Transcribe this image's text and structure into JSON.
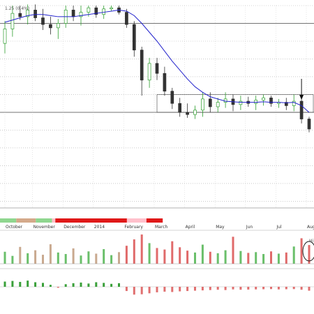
{
  "chart_data": {
    "type": "candlestick",
    "header_text": "1.25 (0.4%)",
    "volume_annotation": "Hi",
    "months": [
      "October",
      "November",
      "December",
      "2014",
      "February",
      "March",
      "April",
      "May",
      "Jun",
      "Jul",
      "August"
    ],
    "bands": [
      {
        "color": "#8fd68f",
        "weeks": 5
      },
      {
        "color": "#d4a98a",
        "weeks": 6
      },
      {
        "color": "#8fd68f",
        "weeks": 5
      },
      {
        "color": "#ffc0cb",
        "weeks": 1
      },
      {
        "color": "#e01818",
        "weeks": 22
      },
      {
        "color": "#ffc0cb",
        "weeks": 6
      },
      {
        "color": "#e01818",
        "weeks": 5
      }
    ],
    "candles": [
      {
        "o": 22.2,
        "h": 24.2,
        "l": 21.3,
        "c": 23.5
      },
      {
        "o": 23.5,
        "h": 25.6,
        "l": 22.8,
        "c": 24.9
      },
      {
        "o": 24.9,
        "h": 25.6,
        "l": 24.3,
        "c": 24.6
      },
      {
        "o": 24.6,
        "h": 25.7,
        "l": 23.9,
        "c": 25.2
      },
      {
        "o": 25.2,
        "h": 25.7,
        "l": 24.2,
        "c": 24.5
      },
      {
        "o": 24.5,
        "h": 25.3,
        "l": 23.4,
        "c": 23.9
      },
      {
        "o": 23.9,
        "h": 24.6,
        "l": 23.0,
        "c": 23.6
      },
      {
        "o": 23.6,
        "h": 24.4,
        "l": 22.6,
        "c": 24.0
      },
      {
        "o": 24.0,
        "h": 25.6,
        "l": 23.6,
        "c": 25.2
      },
      {
        "o": 25.2,
        "h": 25.6,
        "l": 24.2,
        "c": 24.6
      },
      {
        "o": 24.6,
        "h": 25.6,
        "l": 23.8,
        "c": 25.0
      },
      {
        "o": 25.0,
        "h": 25.6,
        "l": 24.6,
        "c": 25.4
      },
      {
        "o": 25.4,
        "h": 25.6,
        "l": 24.5,
        "c": 24.8
      },
      {
        "o": 24.8,
        "h": 25.6,
        "l": 24.4,
        "c": 25.3
      },
      {
        "o": 25.3,
        "h": 25.6,
        "l": 25.1,
        "c": 25.4
      },
      {
        "o": 25.4,
        "h": 25.6,
        "l": 24.8,
        "c": 25.0
      },
      {
        "o": 25.0,
        "h": 25.3,
        "l": 23.6,
        "c": 23.9
      },
      {
        "o": 23.9,
        "h": 24.2,
        "l": 21.0,
        "c": 21.6
      },
      {
        "o": 21.6,
        "h": 21.9,
        "l": 17.5,
        "c": 18.9
      },
      {
        "o": 18.9,
        "h": 20.9,
        "l": 18.2,
        "c": 20.4
      },
      {
        "o": 20.4,
        "h": 20.9,
        "l": 18.9,
        "c": 19.5
      },
      {
        "o": 19.5,
        "h": 20.1,
        "l": 17.5,
        "c": 17.9
      },
      {
        "o": 17.9,
        "h": 18.2,
        "l": 16.3,
        "c": 16.8
      },
      {
        "o": 16.8,
        "h": 17.3,
        "l": 15.6,
        "c": 16.0
      },
      {
        "o": 16.0,
        "h": 16.8,
        "l": 15.5,
        "c": 15.8
      },
      {
        "o": 15.8,
        "h": 16.6,
        "l": 15.4,
        "c": 16.2
      },
      {
        "o": 16.2,
        "h": 17.8,
        "l": 15.6,
        "c": 17.2
      },
      {
        "o": 17.2,
        "h": 17.8,
        "l": 16.0,
        "c": 16.5
      },
      {
        "o": 16.5,
        "h": 17.3,
        "l": 16.0,
        "c": 16.9
      },
      {
        "o": 16.9,
        "h": 17.8,
        "l": 16.4,
        "c": 17.2
      },
      {
        "o": 17.2,
        "h": 17.6,
        "l": 16.1,
        "c": 16.7
      },
      {
        "o": 16.7,
        "h": 17.5,
        "l": 16.2,
        "c": 17.0
      },
      {
        "o": 17.0,
        "h": 17.4,
        "l": 16.5,
        "c": 16.8
      },
      {
        "o": 16.8,
        "h": 17.5,
        "l": 16.2,
        "c": 17.1
      },
      {
        "o": 17.1,
        "h": 17.6,
        "l": 16.6,
        "c": 17.3
      },
      {
        "o": 17.3,
        "h": 17.5,
        "l": 16.5,
        "c": 16.8
      },
      {
        "o": 16.8,
        "h": 17.2,
        "l": 16.4,
        "c": 16.9
      },
      {
        "o": 16.9,
        "h": 17.3,
        "l": 16.2,
        "c": 16.6
      },
      {
        "o": 16.6,
        "h": 17.6,
        "l": 16.1,
        "c": 17.0
      },
      {
        "o": 17.0,
        "h": 17.8,
        "l": 15.0,
        "c": 15.4
      },
      {
        "o": 15.4,
        "h": 15.6,
        "l": 14.2,
        "c": 14.5
      }
    ],
    "ma": [
      24.1,
      24.3,
      24.5,
      24.7,
      24.8,
      24.8,
      24.7,
      24.6,
      24.6,
      24.6,
      24.7,
      24.8,
      24.9,
      25.0,
      25.1,
      25.2,
      25.1,
      24.7,
      24.0,
      23.2,
      22.4,
      21.5,
      20.6,
      19.8,
      19.0,
      18.3,
      17.8,
      17.4,
      17.2,
      17.0,
      16.95,
      16.9,
      16.9,
      16.9,
      16.95,
      16.9,
      16.9,
      16.85,
      16.9,
      16.6,
      16.0
    ],
    "volume": [
      3.2,
      2.1,
      4.5,
      2.8,
      3.6,
      2.4,
      5.2,
      3.0,
      2.6,
      4.1,
      2.2,
      3.3,
      2.7,
      3.9,
      2.3,
      3.1,
      4.8,
      6.5,
      7.8,
      5.5,
      4.2,
      3.8,
      6.0,
      4.4,
      3.5,
      3.0,
      5.1,
      3.2,
      2.8,
      3.6,
      7.2,
      3.4,
      2.9,
      3.1,
      2.6,
      3.3,
      2.7,
      3.0,
      4.6,
      6.8,
      5.0
    ],
    "macd_hist": [
      1.6,
      1.8,
      1.5,
      1.9,
      1.4,
      1.2,
      0.6,
      -0.3,
      0.8,
      1.1,
      1.3,
      1.0,
      1.4,
      1.2,
      0.9,
      1.1,
      -1.3,
      -2.4,
      -2.3,
      -2.0,
      -1.7,
      -1.5,
      -1.6,
      -1.4,
      -1.3,
      -1.2,
      -1.1,
      -1.0,
      -0.9,
      -1.0,
      -0.8,
      -0.9,
      -0.85,
      -0.8,
      -0.75,
      -0.7,
      -0.8,
      -0.75,
      -0.7,
      -0.9,
      -1.2
    ],
    "price_gridlines": [
      25.6,
      24.0,
      22.4,
      20.8,
      19.2,
      17.6,
      16.0,
      14.4,
      12.8,
      11.2,
      9.6,
      8.0
    ],
    "solid_levels": [
      24.0,
      16.0
    ],
    "consolidation_box": {
      "top": 17.6,
      "bottom": 16.0
    },
    "ylim": [
      7.4,
      25.6
    ],
    "volume_ylim": [
      0,
      8
    ],
    "macd_ylim": [
      -3,
      3
    ]
  }
}
